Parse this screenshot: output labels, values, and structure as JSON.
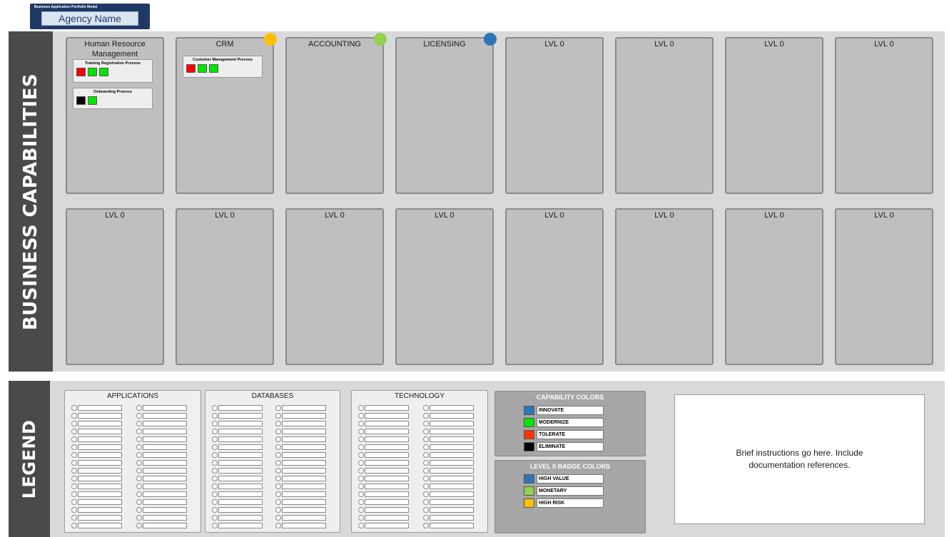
{
  "header": {
    "subtitle": "Business Application Portfolio Model",
    "agency_name": "Agency Name"
  },
  "sections": {
    "capabilities_label": "BUSINESS CAPABILITIES",
    "legend_label": "LEGEND"
  },
  "row1": [
    {
      "title": "Human Resource Management",
      "badge": null
    },
    {
      "title": "CRM",
      "badge": "#ffc000"
    },
    {
      "title": "ACCOUNTING",
      "badge": "#92d050"
    },
    {
      "title": "LICENSING",
      "badge": "#2e75b6"
    },
    {
      "title": "LVL 0",
      "badge": null
    },
    {
      "title": "LVL 0",
      "badge": null
    },
    {
      "title": "LVL 0",
      "badge": null
    },
    {
      "title": "LVL 0",
      "badge": null
    }
  ],
  "row2": [
    {
      "title": "LVL 0"
    },
    {
      "title": "LVL 0"
    },
    {
      "title": "LVL 0"
    },
    {
      "title": "LVL 0"
    },
    {
      "title": "LVL 0"
    },
    {
      "title": "LVL 0"
    },
    {
      "title": "LVL 0"
    },
    {
      "title": "LVL 0"
    }
  ],
  "processes": {
    "training": {
      "title": "Training Registration Process",
      "chips": [
        "#ff0000",
        "#00e600",
        "#00e600"
      ]
    },
    "onboarding": {
      "title": "Onboarding Process",
      "chips": [
        "#000000",
        "#00e600"
      ]
    },
    "customer": {
      "title": "Customer Management Process",
      "chips": [
        "#ff0000",
        "#00e600",
        "#00e600"
      ]
    }
  },
  "legend": {
    "applications_title": "APPLICATIONS",
    "databases_title": "DATABASES",
    "technology_title": "TECHNOLOGY",
    "capability_colors": {
      "title": "CAPABILITY COLORS",
      "items": [
        {
          "label": "INNOVATE",
          "color": "#2e75b6"
        },
        {
          "label": "MODERNIZE",
          "color": "#00e600"
        },
        {
          "label": "TOLERATE",
          "color": "#ff3300"
        },
        {
          "label": "ELIMINATE",
          "color": "#000000"
        }
      ]
    },
    "badge_colors": {
      "title": "LEVEL 0 BADGE COLORS",
      "items": [
        {
          "label": "HIGH VALUE",
          "color": "#2e75b6"
        },
        {
          "label": "MONETARY",
          "color": "#92d050"
        },
        {
          "label": "HIGH RISK",
          "color": "#ffc000"
        }
      ]
    },
    "instructions": "Brief instructions go here. Include documentation references."
  }
}
